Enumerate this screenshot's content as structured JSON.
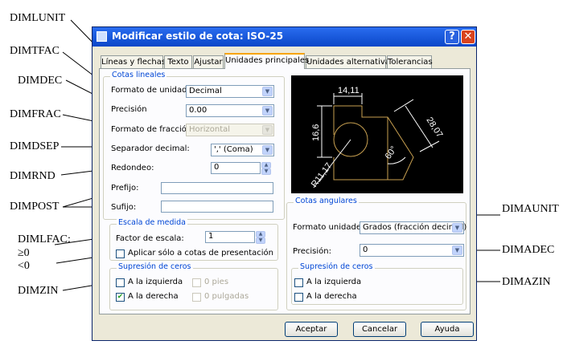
{
  "annotations": {
    "dimlunit": "DIMLUNIT",
    "dimtfac": "DIMTFAC",
    "dimdec": "DIMDEC",
    "dimfrac": "DIMFRAC",
    "dimdsep": "DIMDSEP",
    "dimrnd": "DIMRND",
    "dimpost": "DIMPOST",
    "dimlfac": "DIMLFAC:",
    "dimlfac_ge": "≥0",
    "dimlfac_lt": "<0",
    "dimzin": "DIMZIN",
    "dimaunit": "DIMAUNIT",
    "dimadec": "DIMADEC",
    "dimazin": "DIMAZIN"
  },
  "dialog": {
    "title": "Modificar estilo de cota: ISO-25",
    "help_glyph": "?",
    "close_glyph": "✕",
    "tabs": [
      {
        "label": "Líneas y flechas"
      },
      {
        "label": "Texto"
      },
      {
        "label": "Ajustar"
      },
      {
        "label": "Unidades principales"
      },
      {
        "label": "Unidades alternativas"
      },
      {
        "label": "Tolerancias"
      }
    ],
    "active_tab": "Unidades principales"
  },
  "linear": {
    "group_label": "Cotas lineales",
    "unit_format_label": "Formato de unidades:",
    "unit_format_value": "Decimal",
    "precision_label": "Precisión",
    "precision_value": "0.00",
    "fraction_label": "Formato de fracción:",
    "fraction_value": "Horizontal",
    "decimal_sep_label": "Separador decimal:",
    "decimal_sep_value": "',' (Coma)",
    "round_label": "Redondeo:",
    "round_value": "0",
    "prefix_label": "Prefijo:",
    "prefix_value": "",
    "suffix_label": "Sufijo:",
    "suffix_value": ""
  },
  "scale": {
    "group_label": "Escala de medida",
    "factor_label": "Factor de escala:",
    "factor_value": "1",
    "layout_only_label": "Aplicar sólo a cotas de presentación",
    "layout_only_checked": false
  },
  "zero_linear": {
    "group_label": "Supresión de ceros",
    "leading_label": "A la izquierda",
    "leading_checked": false,
    "trailing_label": "A la derecha",
    "trailing_checked": true,
    "feet_label": "0 pies",
    "inches_label": "0 pulgadas"
  },
  "preview": {
    "dim_top": "14,11",
    "dim_left": "16,6",
    "dim_diag": "28,07",
    "dim_angle": "60°",
    "dim_radius": "R11,17"
  },
  "angular": {
    "group_label": "Cotas angulares",
    "unit_format_label": "Formato unidades:",
    "unit_format_value": "Grados (fracción decimal)",
    "precision_label": "Precisión:",
    "precision_value": "0"
  },
  "zero_angular": {
    "group_label": "Supresión de ceros",
    "leading_label": "A la izquierda",
    "leading_checked": false,
    "trailing_label": "A la derecha",
    "trailing_checked": false
  },
  "buttons": {
    "ok": "Aceptar",
    "cancel": "Cancelar",
    "help": "Ayuda"
  },
  "colors": {
    "title_bar": "#0a46c8",
    "group_label": "#0046d5",
    "preview_bg": "#000000",
    "preview_geometry": "#c8a050"
  }
}
